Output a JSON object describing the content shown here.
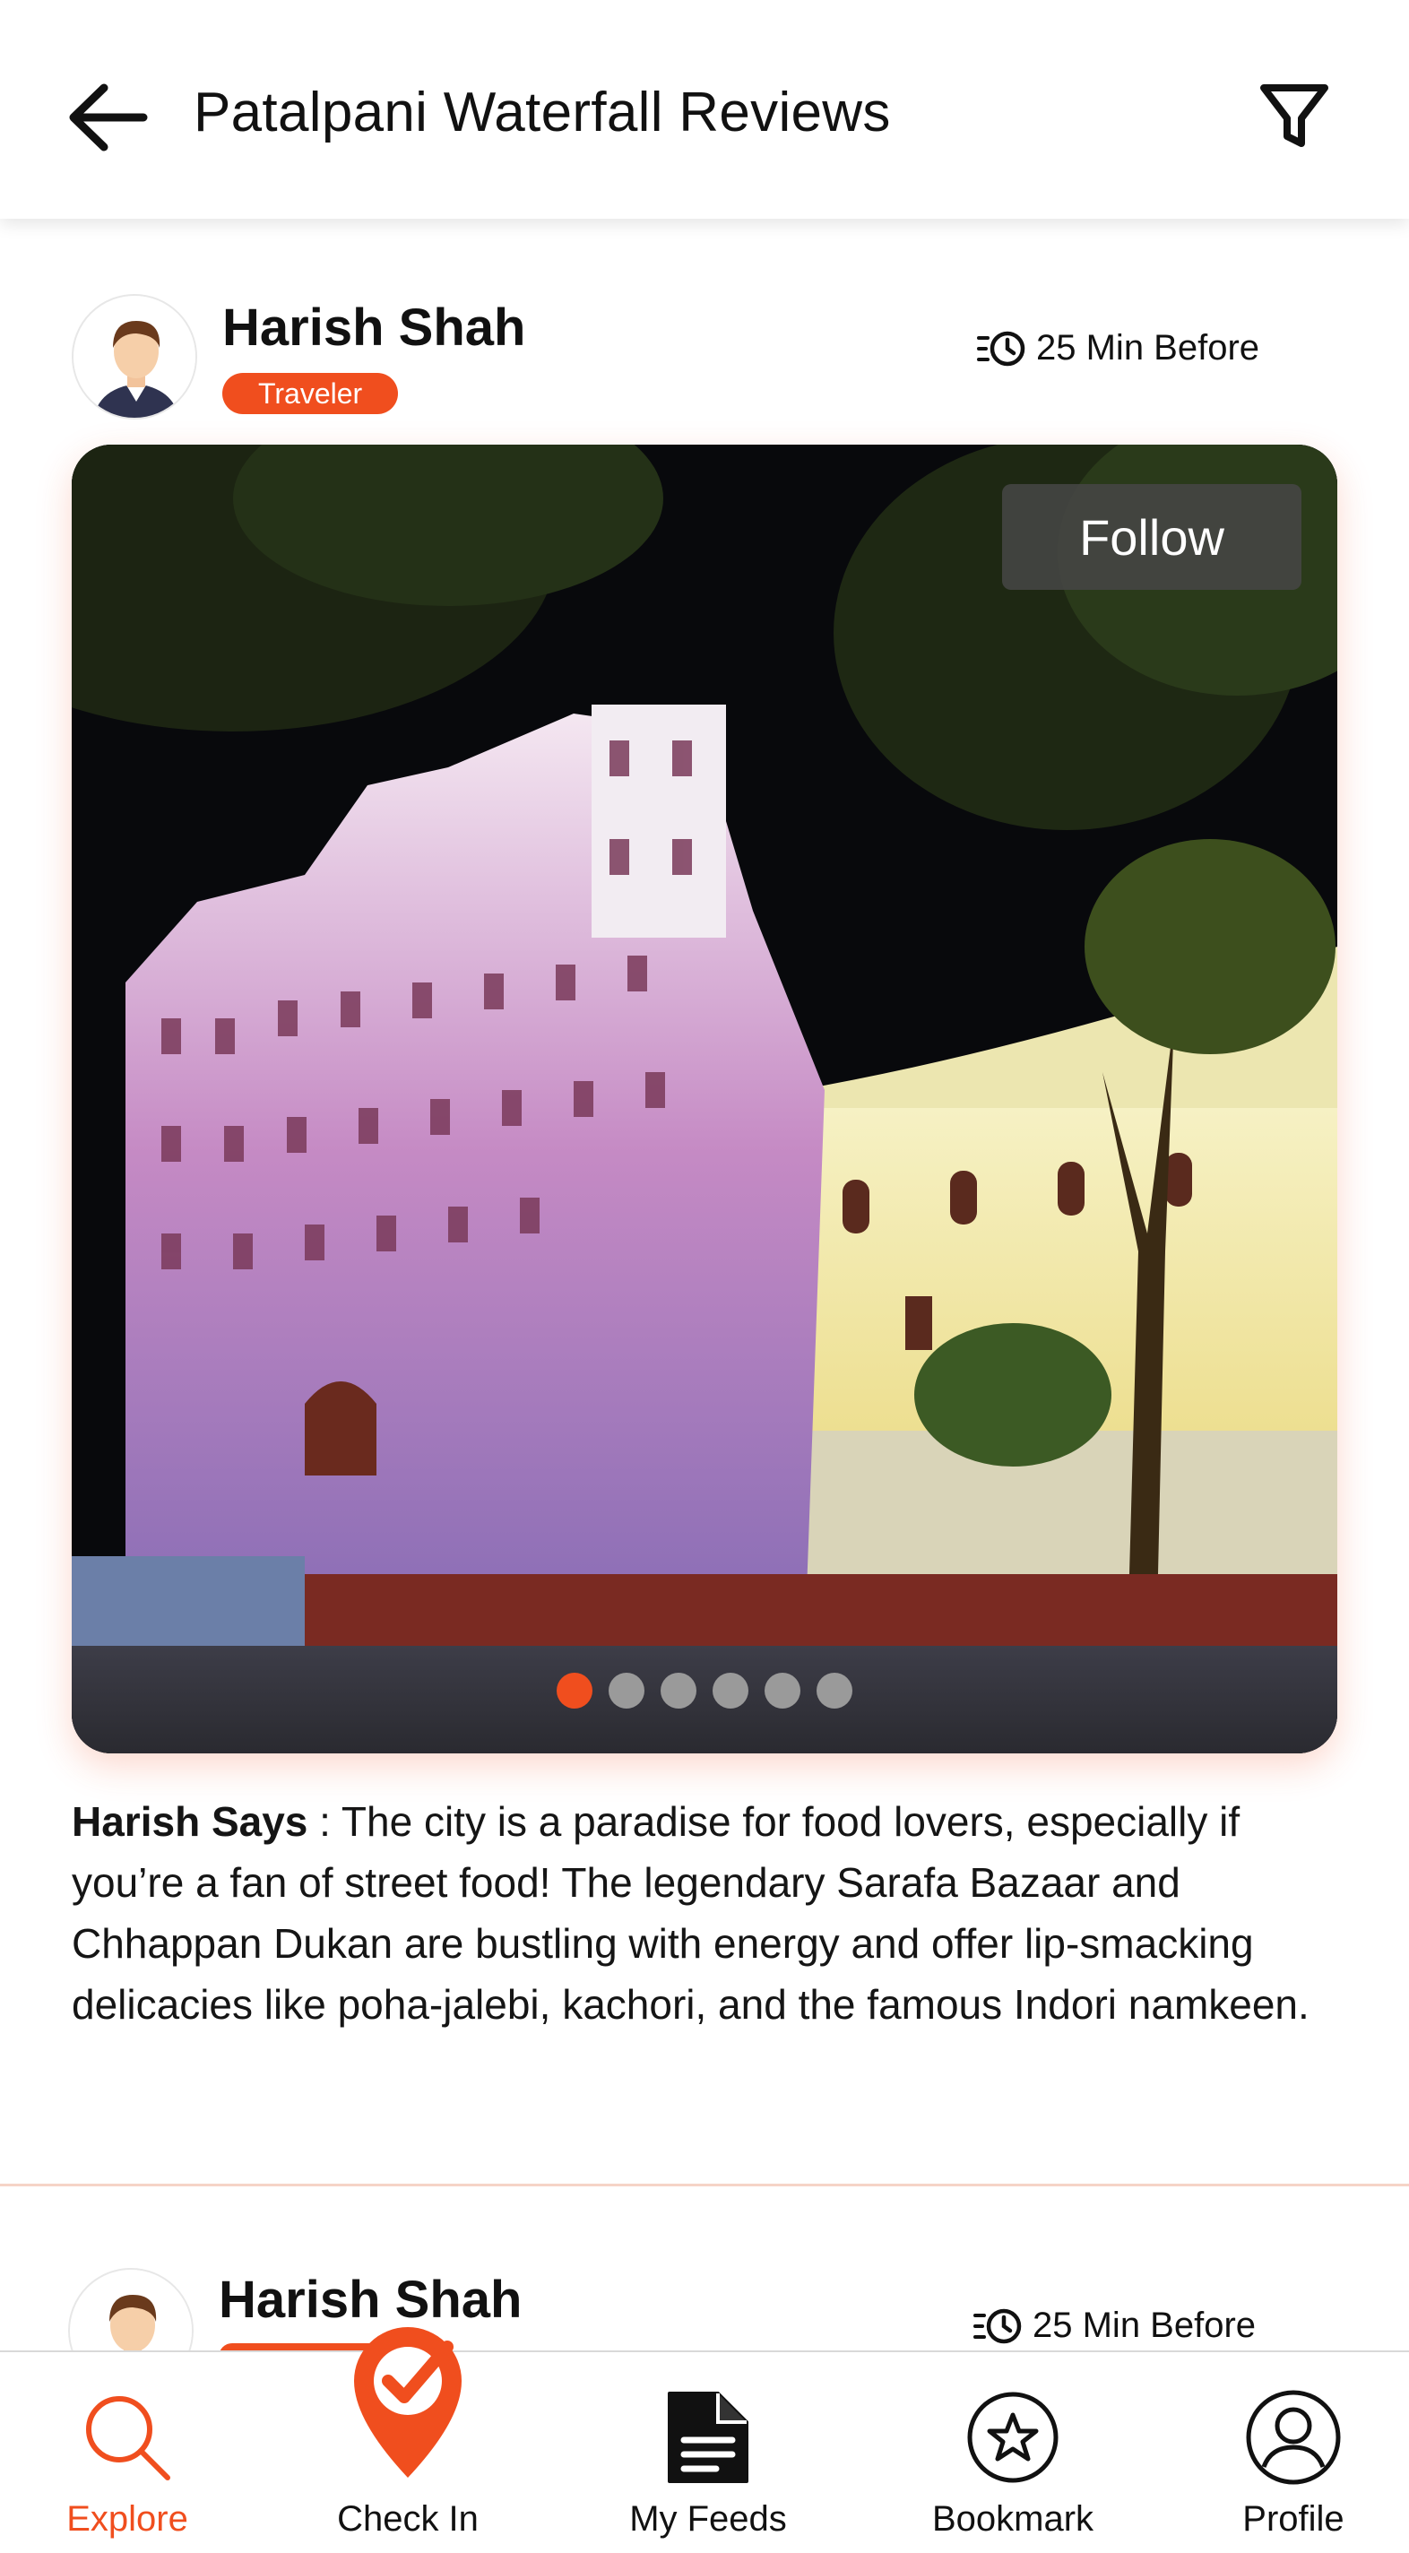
{
  "header": {
    "title": "Patalpani Waterfall Reviews",
    "back_icon": "arrow-left-icon",
    "filter_icon": "filter-icon"
  },
  "reviews": [
    {
      "author": "Harish Shah",
      "badge": "Traveler",
      "time": "25 Min Before",
      "follow_label": "Follow",
      "says_label": "Harish Says",
      "separator": " : ",
      "text": "The city is a paradise for food lovers, especially if you’re a fan of street food! The legendary Sarafa Bazaar and Chhappan Dukan are bustling with energy and offer lip-smacking delicacies like poha-jalebi, kachori, and the famous Indori namkeen.",
      "carousel_total": 6,
      "carousel_active": 1
    },
    {
      "author": "Harish Shah",
      "time": "25 Min Before"
    }
  ],
  "nav": {
    "items": [
      {
        "label": "Explore",
        "icon": "search-icon",
        "active": true
      },
      {
        "label": "Check In",
        "icon": "check-in-pin-icon",
        "active": false
      },
      {
        "label": "My Feeds",
        "icon": "document-icon",
        "active": false
      },
      {
        "label": "Bookmark",
        "icon": "star-icon",
        "active": false
      },
      {
        "label": "Profile",
        "icon": "user-icon",
        "active": false
      }
    ]
  },
  "colors": {
    "accent": "#f04e1e",
    "text": "#111111",
    "divider": "#f6d4c7"
  }
}
